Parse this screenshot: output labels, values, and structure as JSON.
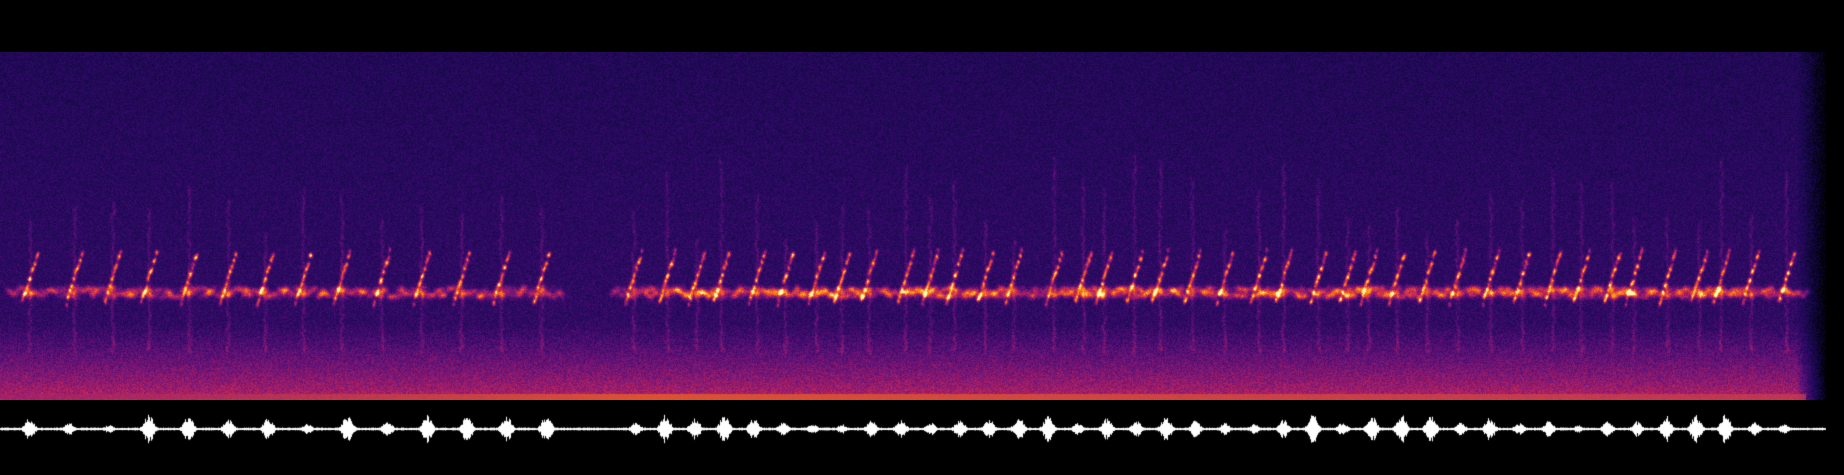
{
  "recording": {
    "view": "spectrogram-with-waveform",
    "colormap": "inferno",
    "colors": {
      "background": "#000000",
      "noise_floor": "#220a5a",
      "call_low": "#c0206a",
      "call_mid": "#f5600a",
      "call_peak": "#fff5b0",
      "waveform": "#ffffff"
    },
    "call_bouts": [
      {
        "start": 0.005,
        "end": 0.31
      },
      {
        "start": 0.34,
        "end": 0.985
      }
    ],
    "call_count": 54
  }
}
